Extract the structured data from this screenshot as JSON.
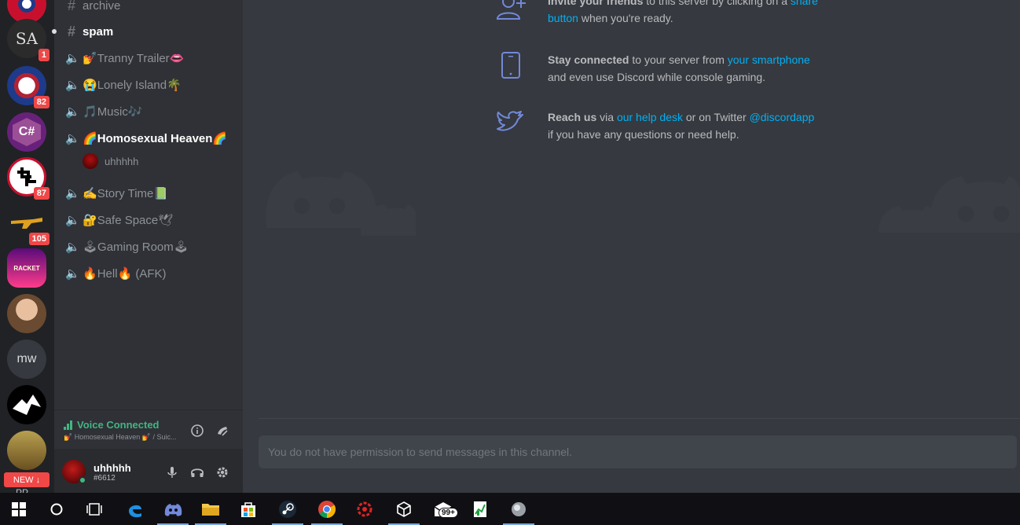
{
  "rail": {
    "servers": [
      {
        "initials": "",
        "badge": "",
        "color": "#c8102e"
      },
      {
        "initials": "SA",
        "badge": "1",
        "color": "#2b2b2b"
      },
      {
        "initials": "",
        "badge": "82",
        "color": "#1e3a8a"
      },
      {
        "initials": "C#",
        "badge": "",
        "color": "#68217a"
      },
      {
        "initials": "",
        "badge": "87",
        "color": "#ffffff"
      },
      {
        "initials": "",
        "badge": "105",
        "color": "#202225"
      },
      {
        "initials": "RACKET",
        "badge": "",
        "color": "#3a0a5a"
      },
      {
        "initials": "",
        "badge": "",
        "color": "#8a6a4a"
      },
      {
        "initials": "mw",
        "badge": "",
        "color": "#36393f"
      },
      {
        "initials": "",
        "badge": "",
        "color": "#000000"
      },
      {
        "initials": "",
        "badge": "",
        "color": "#b8a050"
      }
    ],
    "new_label": "NEW",
    "partial_label": "PP"
  },
  "channels": {
    "text": [
      {
        "name": "archive"
      },
      {
        "name": "spam"
      }
    ],
    "voice": [
      {
        "name": "Tranny Trailer",
        "pre": "💅",
        "post": "👄"
      },
      {
        "name": "Lonely Island",
        "pre": "😭",
        "post": "🌴"
      },
      {
        "name": "Music",
        "pre": "🎵",
        "post": "🎶"
      },
      {
        "name": "Homosexual Heaven",
        "pre": "🌈",
        "post": "🌈"
      },
      {
        "name": "Story Time",
        "pre": "✍",
        "post": "📗"
      },
      {
        "name": "Safe Space",
        "pre": "🔐",
        "post": "🕊"
      },
      {
        "name": "Gaming Room",
        "pre": "🕹",
        "post": "🕹"
      },
      {
        "name": "Hell",
        "pre": "🔥",
        "post": "🔥 (AFK)"
      }
    ],
    "voice_user": "uhhhhh"
  },
  "voice_status": {
    "title": "Voice Connected",
    "subtitle": "💅 Homosexual Heaven 💅 / Suic..."
  },
  "user": {
    "name": "uhhhhh",
    "tag": "#6612"
  },
  "main": {
    "tips": [
      {
        "bold": "Invite your friends",
        "t1": " to this server by clicking on a ",
        "link": "share button",
        "t2": " when you're ready.",
        "link2": "",
        "t3": ""
      },
      {
        "bold": "Stay connected",
        "t1": " to your server from ",
        "link": "your smartphone",
        "t2": " and even use Discord while console gaming.",
        "link2": "",
        "t3": ""
      },
      {
        "bold": "Reach us",
        "t1": " via ",
        "link": "our help desk",
        "t2": " or on Twitter ",
        "link2": "@discordapp",
        "t3": " if you have any questions or need help."
      }
    ],
    "composer_placeholder": "You do not have permission to send messages in this channel."
  },
  "taskbar": {
    "mail_badge": "99+"
  },
  "colors": {
    "accent": "#7289da",
    "link": "#00b0f4",
    "voice_green": "#43b581",
    "badge_red": "#f04747"
  }
}
